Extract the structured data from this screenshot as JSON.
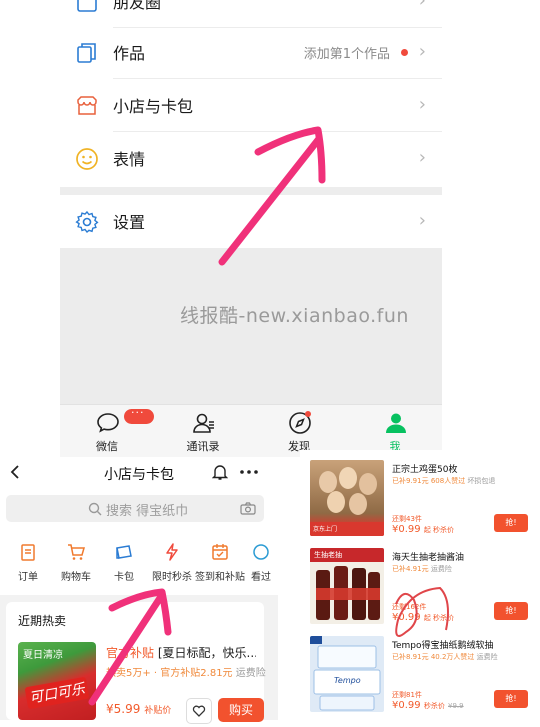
{
  "wechat_me": {
    "menu": [
      {
        "label": "朋友圈",
        "icon": "moments-icon"
      },
      {
        "label": "作品",
        "icon": "works-icon",
        "hint": "添加第1个作品"
      },
      {
        "label": "小店与卡包",
        "icon": "shop-icon"
      },
      {
        "label": "表情",
        "icon": "emoji-icon"
      },
      {
        "label": "设置",
        "icon": "settings-icon"
      }
    ],
    "watermark": "线报酷-new.xianbao.fun",
    "tabs": [
      {
        "label": "微信",
        "icon": "chat-icon",
        "badge": "···"
      },
      {
        "label": "通讯录",
        "icon": "contacts-icon"
      },
      {
        "label": "发现",
        "icon": "discover-compass-icon"
      },
      {
        "label": "我",
        "icon": "me-icon",
        "active": true
      }
    ],
    "colors": {
      "accent_green": "#07c160",
      "red_dot": "#f04a3c"
    }
  },
  "card_wallet": {
    "title": "小店与卡包",
    "search_placeholder": "搜索 得宝纸巾",
    "shortcuts": [
      {
        "label": "订单",
        "icon": "order-icon"
      },
      {
        "label": "购物车",
        "icon": "cart-icon"
      },
      {
        "label": "卡包",
        "icon": "card-icon"
      },
      {
        "label": "限时秒杀",
        "icon": "flash-sale-icon"
      },
      {
        "label": "签到和补贴",
        "icon": "checkin-icon"
      },
      {
        "label": "看过",
        "icon": "history-icon"
      }
    ],
    "hot": {
      "section_title": "近期热卖",
      "image_texts": {
        "top": "夏日清凉",
        "logo": "可口可乐"
      },
      "name_prefix": "官方补贴",
      "name": "[夏日标配，快乐...",
      "sold": "热卖5万+",
      "subsidy": "官方补贴2.81元",
      "shipping": "运费险",
      "price": "¥5.99",
      "price_tag": "补贴价",
      "buy_label": "购买"
    }
  },
  "product_list": [
    {
      "name": "正宗土鸡蛋50枚",
      "saved": "已补9.91元",
      "praise": "608人赞过",
      "extra": "坏损包退",
      "sold": "还剩43件",
      "price": "¥0.99",
      "price_tag": "起 秒杀价",
      "button": "抢!",
      "thumb_badge": "京东上门"
    },
    {
      "name": "海天生抽老抽酱油",
      "saved": "已补4.91元",
      "extra": "运费险",
      "sold": "还剩162件",
      "price": "¥0.99",
      "price_tag": "起 秒杀价",
      "button": "抢!",
      "thumb_badge": "生抽老抽"
    },
    {
      "name": "Tempo得宝抽纸鹅绒软抽",
      "saved": "已补8.91元",
      "praise": "40.2万人赞过",
      "extra": "运费险",
      "sold": "还剩81件",
      "price": "¥0.99",
      "price_tag": "秒杀价",
      "old_price": "¥9.9",
      "button": "抢!",
      "thumb_badge": "Tempo"
    }
  ]
}
